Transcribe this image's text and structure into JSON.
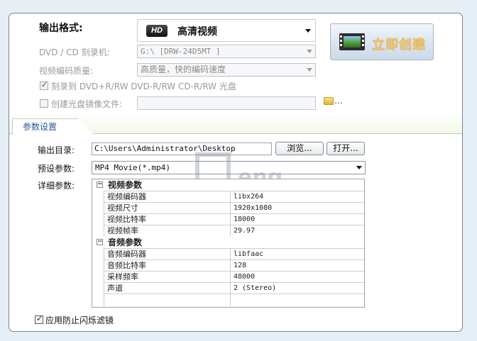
{
  "output_format": {
    "label": "输出格式:",
    "badge": "HD",
    "selected": "高清视频"
  },
  "create_button": {
    "label": "立即创建"
  },
  "disc": {
    "burner_label": "DVD / CD 刻录机:",
    "burner_value": "G:\\ [DRW-24D5MT      ]",
    "quality_label": "视频编码质量:",
    "quality_value": "高质量，快的编码速度",
    "burn_checkbox": "刻录到 DVD+R/RW DVD-R/RW CD-R/RW 光盘",
    "iso_checkbox": "创建光盘镜像文件:",
    "iso_path": "",
    "browse_dots": "…"
  },
  "tab": {
    "label": "参数设置"
  },
  "params": {
    "output_dir_label": "输出目录:",
    "output_dir_value": "C:\\Users\\Administrator\\Desktop",
    "browse_button": "浏览...",
    "open_button": "打开...",
    "preset_label": "预设参数:",
    "preset_value": "MP4 Movie(*.mp4)",
    "detail_label": "详细参数:",
    "video_group": "视频参数",
    "video_rows": [
      {
        "key": "视频编码器",
        "value": "libx264"
      },
      {
        "key": "视频尺寸",
        "value": "1920x1080"
      },
      {
        "key": "视频比特率",
        "value": "18000"
      },
      {
        "key": "视频帧率",
        "value": "29.97"
      }
    ],
    "audio_group": "音频参数",
    "audio_rows": [
      {
        "key": "音频编码器",
        "value": "libfaac"
      },
      {
        "key": "音频比特率",
        "value": "128"
      },
      {
        "key": "采样频率",
        "value": "48000"
      },
      {
        "key": "声道",
        "value": "2 (Stereo)"
      }
    ],
    "deflicker_checkbox": "应用防止闪烁滤镜"
  },
  "watermark": {
    "text": "eng"
  },
  "colors": {
    "panel_bg": "#ffffff",
    "page_bg": "#e6eef6",
    "tab_text": "#2a56a0",
    "create_text": "#f3c468"
  }
}
